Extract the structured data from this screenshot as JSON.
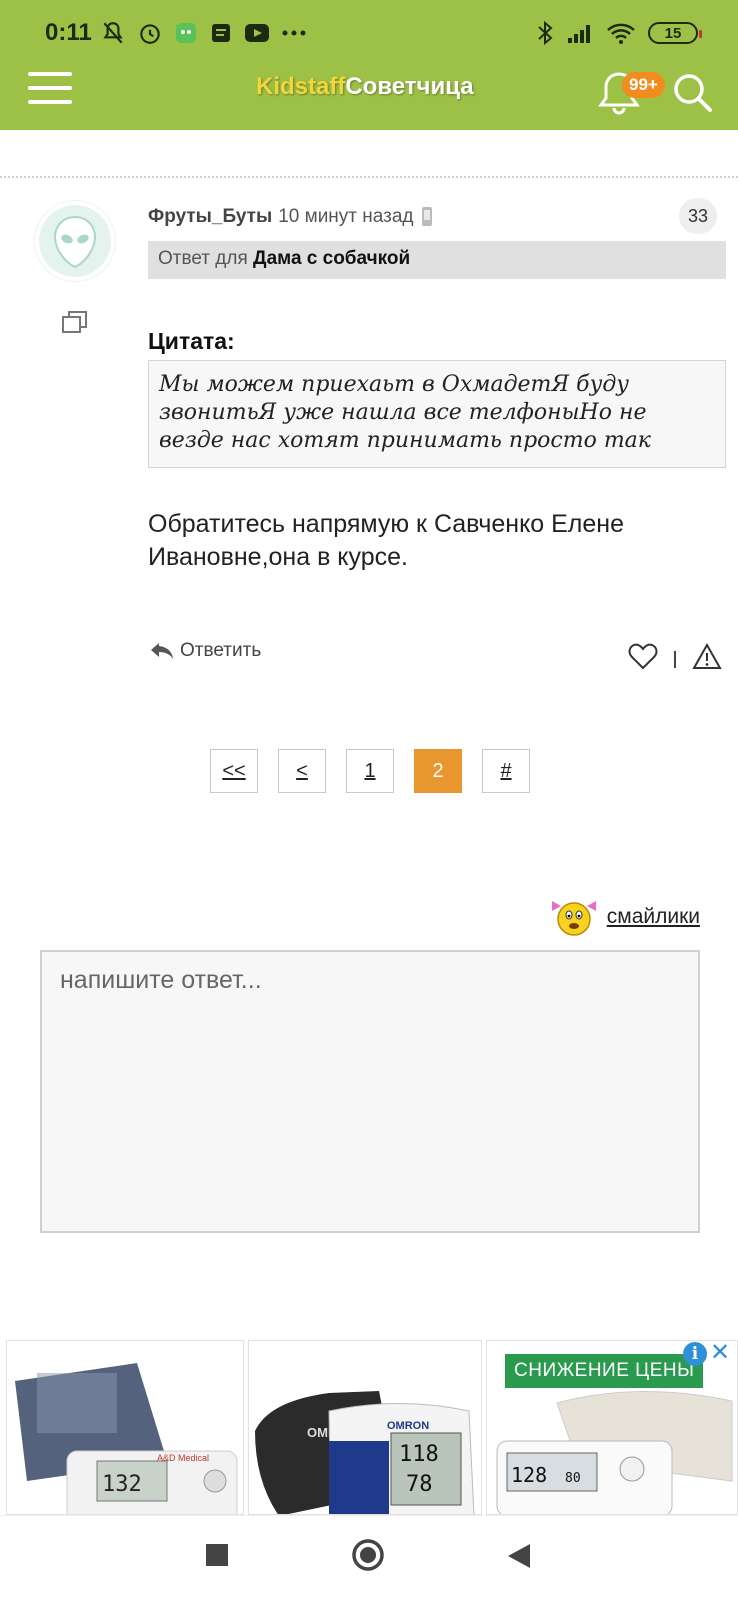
{
  "status_bar": {
    "time": "0:11",
    "battery": "15",
    "left_icons": [
      "mute-icon",
      "alarm-icon",
      "app-icon",
      "notes-icon",
      "youtube-icon",
      "more-icon"
    ],
    "right_icons": [
      "bluetooth-icon",
      "signal-icon",
      "wifi-icon",
      "battery-icon"
    ]
  },
  "app_bar": {
    "title_part1": "Kidstaff",
    "title_part2": "Советчица",
    "notification_count": "99+",
    "colors": {
      "bar": "#9dc146",
      "badge": "#f28c1e",
      "title_accent": "#f4d63b"
    }
  },
  "post": {
    "author": "Фруты_Буты",
    "time_ago": "10 минут назад",
    "number": "33",
    "reply_prefix": "Ответ для",
    "reply_to": "Дама с собачкой",
    "quote_title": "Цитата:",
    "quote_text": "Мы можем приехаьт в ОхмадетЯ буду звонитьЯ уже нашла все телфоныНо не везде нас хотят принимать просто так",
    "body": "Обратитесь напрямую к Савченко Елене Ивановне,она в курсе.",
    "reply_label": "Ответить"
  },
  "pagination": {
    "items": [
      "<<",
      "<",
      "1",
      "2",
      "#"
    ],
    "active": "2",
    "active_color": "#e8962e"
  },
  "editor": {
    "smileys_label": "смайлики",
    "placeholder": "напишите ответ..."
  },
  "ads": {
    "label": "СНИЖЕНИЕ ЦЕНЫ",
    "label_color": "#2a9a4e",
    "card1_brand": "A&D Medical",
    "card1_reading": "132",
    "card2_brand": "OMRON",
    "card2_sys": "118",
    "card2_dia": "78",
    "card3_sys": "128",
    "card3_dia": "80"
  }
}
